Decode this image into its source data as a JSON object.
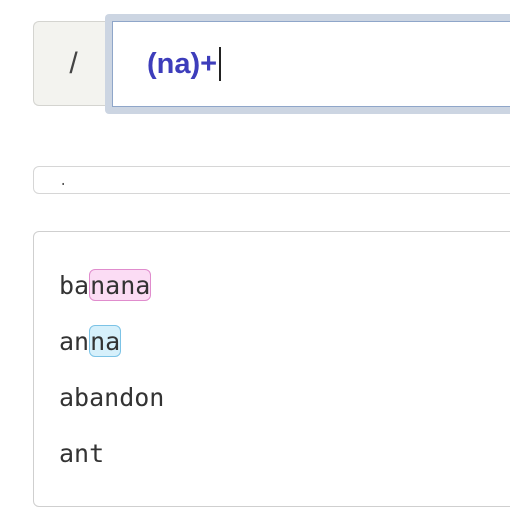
{
  "regex": {
    "delimiter": "/",
    "pattern": "(na)+"
  },
  "flags": {
    "text": "."
  },
  "test_strings": [
    {
      "pre": "ba",
      "match": "nana",
      "post": "",
      "match_color": "pink"
    },
    {
      "pre": "an",
      "match": "na",
      "post": "",
      "match_color": "blue"
    },
    {
      "pre": "abandon",
      "match": "",
      "post": "",
      "match_color": ""
    },
    {
      "pre": "ant",
      "match": "",
      "post": "",
      "match_color": ""
    }
  ],
  "colors": {
    "pattern_text": "#3d3dbb",
    "match_pink_bg": "#fbdcf4",
    "match_blue_bg": "#d6f0fb"
  }
}
